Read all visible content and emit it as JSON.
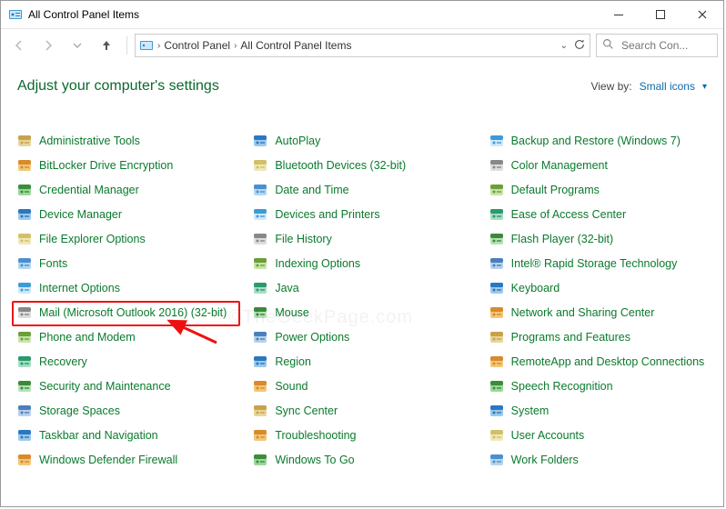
{
  "titlebar": {
    "title": "All Control Panel Items"
  },
  "breadcrumbs": {
    "segments": [
      "Control Panel",
      "All Control Panel Items"
    ]
  },
  "search": {
    "placeholder": "Search Con..."
  },
  "heading": "Adjust your computer's settings",
  "viewby": {
    "label": "View by:",
    "value": "Small icons"
  },
  "watermark": "©TheGeekPage.com",
  "columns": [
    [
      "Administrative Tools",
      "BitLocker Drive Encryption",
      "Credential Manager",
      "Device Manager",
      "File Explorer Options",
      "Fonts",
      "Internet Options",
      "Mail (Microsoft Outlook 2016) (32-bit)",
      "Phone and Modem",
      "Recovery",
      "Security and Maintenance",
      "Storage Spaces",
      "Taskbar and Navigation",
      "Windows Defender Firewall"
    ],
    [
      "AutoPlay",
      "Bluetooth Devices (32-bit)",
      "Date and Time",
      "Devices and Printers",
      "File History",
      "Indexing Options",
      "Java",
      "Mouse",
      "Power Options",
      "Region",
      "Sound",
      "Sync Center",
      "Troubleshooting",
      "Windows To Go"
    ],
    [
      "Backup and Restore (Windows 7)",
      "Color Management",
      "Default Programs",
      "Ease of Access Center",
      "Flash Player (32-bit)",
      "Intel® Rapid Storage Technology",
      "Keyboard",
      "Network and Sharing Center",
      "Programs and Features",
      "RemoteApp and Desktop Connections",
      "Speech Recognition",
      "System",
      "User Accounts",
      "Work Folders"
    ]
  ],
  "highlighted_item": "Mail (Microsoft Outlook 2016) (32-bit)"
}
